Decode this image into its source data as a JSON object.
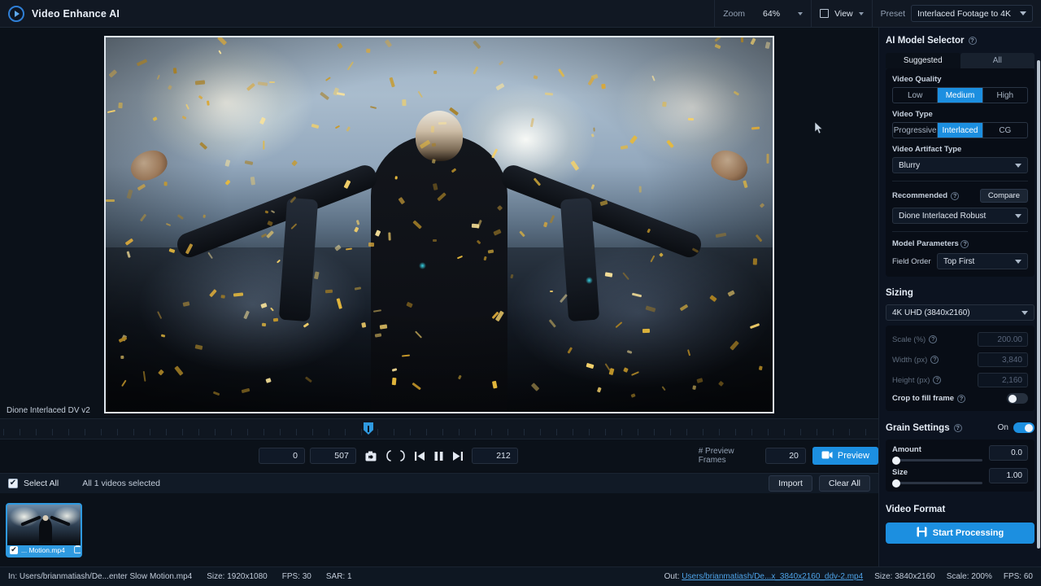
{
  "app": {
    "name": "Video Enhance AI",
    "logo_icon": "play-logo-icon"
  },
  "toolbar": {
    "zoom_label": "Zoom",
    "zoom_value": "64%",
    "view_label": "View",
    "view_icon": "square-icon",
    "preset_label": "Preset",
    "preset_value": "Interlaced Footage to 4K",
    "chevron_icon": "chevron-down-icon"
  },
  "preview": {
    "model_label": "Dione Interlaced DV v2"
  },
  "transport": {
    "in_frame": "0",
    "out_frame": "507",
    "current_frame": "212",
    "snapshot_icon": "camera-snapshot-icon",
    "set_in_icon": "set-in-point-icon",
    "set_out_icon": "set-out-point-icon",
    "step_back_icon": "step-backward-icon",
    "pause_icon": "pause-icon",
    "step_forward_icon": "step-forward-icon",
    "preview_frames_label": "# Preview Frames",
    "preview_frames_value": "20",
    "preview_button": "Preview",
    "preview_button_icon": "video-preview-icon"
  },
  "selection": {
    "select_all_label": "Select All",
    "status": "All 1 videos selected",
    "import_label": "Import",
    "clear_all_label": "Clear All",
    "check_icon": "checkmark-icon"
  },
  "filmstrip": {
    "items": [
      {
        "name": "... Motion.mp4",
        "selected": true,
        "delete_icon": "trash-icon"
      }
    ]
  },
  "panel": {
    "model_selector": {
      "title": "AI Model Selector",
      "help_icon": "help-circle-icon",
      "tabs": [
        {
          "label": "Suggested",
          "active": true
        },
        {
          "label": "All",
          "active": false
        }
      ],
      "video_quality_label": "Video Quality",
      "video_quality_options": [
        {
          "label": "Low",
          "active": false
        },
        {
          "label": "Medium",
          "active": true
        },
        {
          "label": "High",
          "active": false
        }
      ],
      "video_type_label": "Video Type",
      "video_type_options": [
        {
          "label": "Progressive",
          "active": false
        },
        {
          "label": "Interlaced",
          "active": true
        },
        {
          "label": "CG",
          "active": false
        }
      ],
      "artifact_label": "Video Artifact Type",
      "artifact_value": "Blurry",
      "recommended_label": "Recommended",
      "compare_label": "Compare",
      "recommended_value": "Dione Interlaced Robust",
      "model_params_label": "Model Parameters",
      "field_order_label": "Field Order",
      "field_order_value": "Top First"
    },
    "sizing": {
      "title": "Sizing",
      "preset_value": "4K UHD (3840x2160)",
      "scale_label": "Scale (%)",
      "scale_value": "200.00",
      "width_label": "Width (px)",
      "width_value": "3,840",
      "height_label": "Height (px)",
      "height_value": "2,160",
      "crop_label": "Crop to fill frame",
      "crop_on": false
    },
    "grain": {
      "title": "Grain Settings",
      "toggle_label": "On",
      "toggle_on": true,
      "amount_label": "Amount",
      "amount_value": "0.0",
      "size_label": "Size",
      "size_value": "1.00"
    },
    "video_format": {
      "title": "Video Format"
    },
    "start_button": {
      "label": "Start Processing",
      "icon": "save-disk-icon"
    }
  },
  "statusbar": {
    "in_prefix": "In:",
    "in_path": "Users/brianmatiash/De...enter Slow Motion.mp4",
    "in_size": "Size: 1920x1080",
    "in_fps": "FPS: 30",
    "in_sar": "SAR: 1",
    "out_prefix": "Out:",
    "out_path": "Users/brianmatiash/De...x_3840x2160_ddv-2.mp4",
    "out_size": "Size: 3840x2160",
    "out_scale": "Scale: 200%",
    "out_fps": "FPS: 60"
  },
  "colors": {
    "accent": "#1c8fe0",
    "panel_bg": "#0c1320",
    "app_bg": "#0a0f17"
  }
}
